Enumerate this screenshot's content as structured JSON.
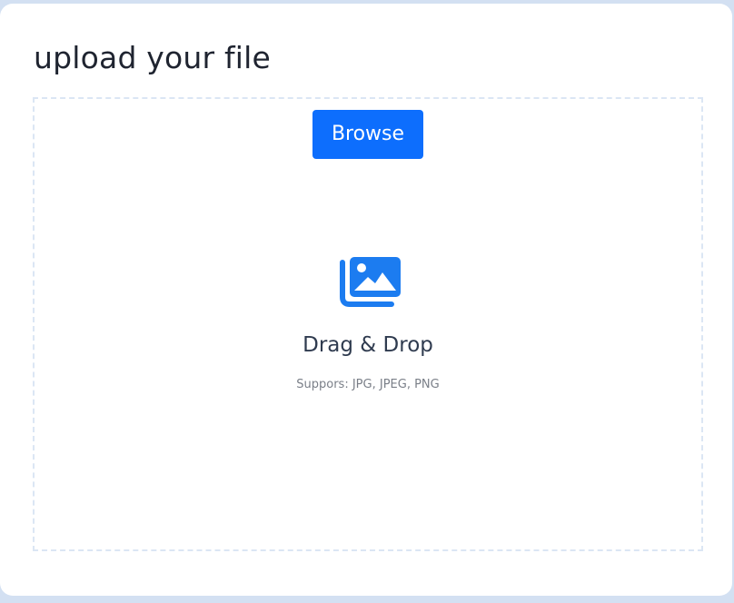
{
  "upload": {
    "title": "upload your file",
    "browse_label": "Browse",
    "drop_title": "Drag & Drop",
    "drop_hint": "Suppors: JPG, JPEG, PNG"
  },
  "icons": {
    "drop_icon": "images-icon"
  },
  "colors": {
    "accent": "#0d6efd",
    "icon": "#1c7cf0",
    "background": "#d3e0f2",
    "dropzone_border": "#dbe6f4"
  }
}
